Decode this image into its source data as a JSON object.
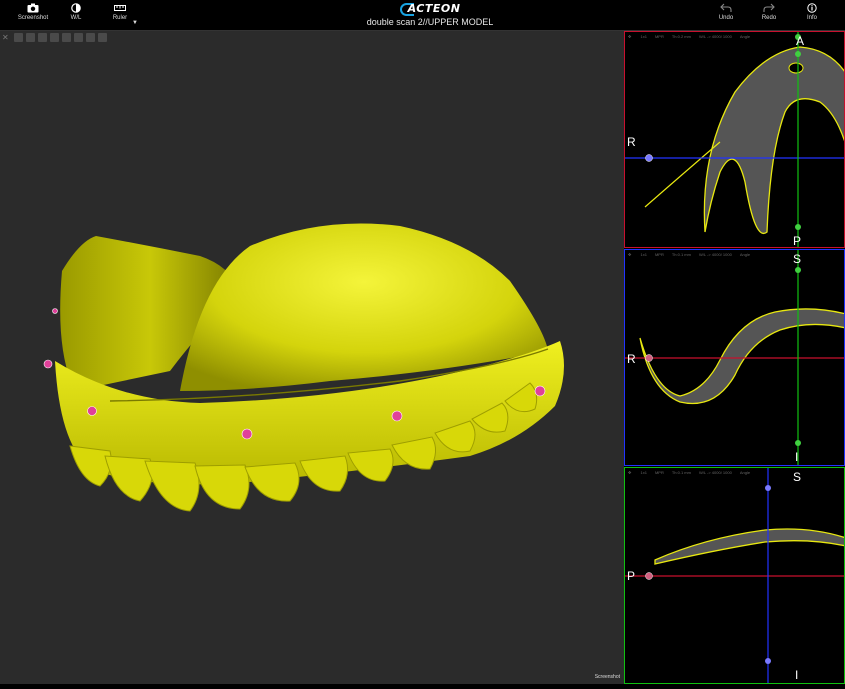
{
  "toolbar": {
    "screenshot_label": "Screenshot",
    "wl_label": "W/L",
    "ruler_label": "Ruler",
    "undo_label": "Undo",
    "redo_label": "Redo",
    "info_label": "Info"
  },
  "app": {
    "brand": "ACTEON",
    "document_title": "double scan 2//UPPER MODEL"
  },
  "main_view": {
    "screenshot_label": "Screenshot"
  },
  "panes": [
    {
      "header": [
        "1x1",
        "MPR",
        "Th:0.2 mm",
        "W/L -> 4000/ 1000",
        "Angle"
      ],
      "labels": {
        "top": "A",
        "left": "R",
        "bottom": "P"
      },
      "colors": {
        "border": "#c8102e",
        "h_line": "#2233ff",
        "v_line": "#10c010"
      }
    },
    {
      "header": [
        "1x1",
        "MPR",
        "Th:0.1 mm",
        "W/L -> 4000/ 1000",
        "Angle"
      ],
      "labels": {
        "top": "S",
        "left": "R",
        "bottom": "I"
      },
      "colors": {
        "border": "#2233ff",
        "h_line": "#c8102e",
        "v_line": "#10c010"
      }
    },
    {
      "header": [
        "1x1",
        "MPR",
        "Th:0.1 mm",
        "W/L -> 4000/ 1000",
        "Angle"
      ],
      "labels": {
        "top": "S",
        "left": "P",
        "bottom": "I"
      },
      "colors": {
        "border": "#10c010",
        "h_line": "#c8102e",
        "v_line": "#2233ff"
      }
    }
  ],
  "colors": {
    "model_yellow": "#e8e810",
    "marker_pink": "#e0409a",
    "accent_blue": "#19a3e0"
  }
}
